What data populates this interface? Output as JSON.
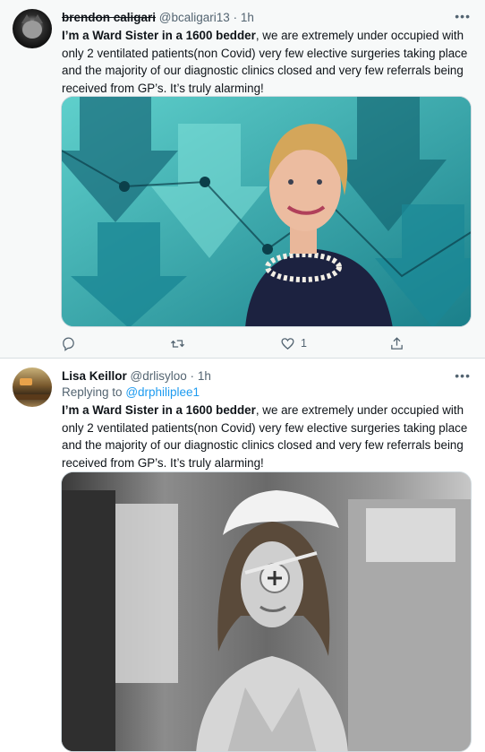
{
  "tweets": [
    {
      "display_name": "brendon caligari",
      "handle": "@bcaligari13",
      "separator": "·",
      "time": "1h",
      "more": "•••",
      "body_bold": "I’m a Ward Sister in a 1600 bedder",
      "body_rest": ", we are extremely under occupied with only 2 ventilated patients(non Covid) very few elective surgeries taking place and the majority of our diagnostic clinics closed and very few referrals being received from GP’s. It’s truly alarming!",
      "actions": {
        "reply_icon": "reply-icon",
        "retweet_icon": "retweet-icon",
        "like_icon": "heart-icon",
        "like_count": "1",
        "share_icon": "share-icon"
      }
    },
    {
      "display_name": "Lisa Keillor",
      "handle": "@drlisyloo",
      "separator": "·",
      "time": "1h",
      "more": "•••",
      "replying_to_label": "Replying to",
      "replying_to_handle": "@drphiliplee1",
      "body_bold": "I’m a Ward Sister in a 1600 bedder",
      "body_rest": ", we are extremely under occupied with only 2 ventilated patients(non Covid) very few elective surgeries taking place and the majority of our diagnostic clinics closed and very few referrals being received from GP’s. It’s truly alarming!"
    }
  ],
  "colors": {
    "link": "#1d9bf0",
    "secondary_text": "#536471",
    "primary_text": "#0f1419",
    "highlight_bg": "#f7f9f9"
  }
}
